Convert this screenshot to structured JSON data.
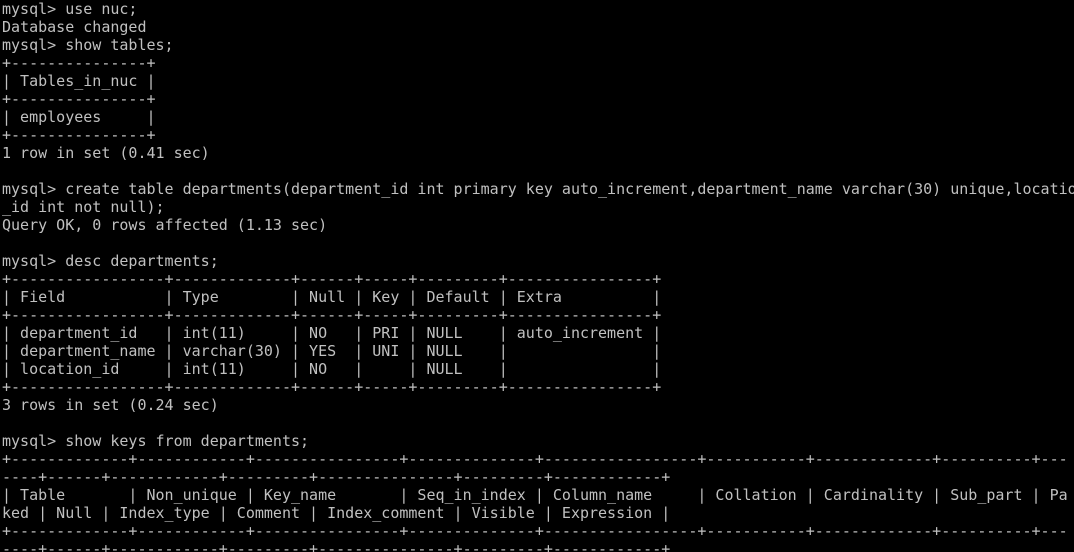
{
  "window": {
    "type": "terminal",
    "background": "#000000",
    "foreground": "#c0c0c0"
  },
  "console": {
    "lines": [
      "mysql> use nuc;",
      "Database changed",
      "mysql> show tables;",
      "+---------------+",
      "| Tables_in_nuc |",
      "+---------------+",
      "| employees     |",
      "+---------------+",
      "1 row in set (0.41 sec)",
      "",
      "mysql> create table departments(department_id int primary key auto_increment,department_name varchar(30) unique,locatio",
      "_id int not null);",
      "Query OK, 0 rows affected (1.13 sec)",
      "",
      "mysql> desc departments;",
      "+-----------------+-------------+------+-----+---------+----------------+",
      "| Field           | Type        | Null | Key | Default | Extra          |",
      "+-----------------+-------------+------+-----+---------+----------------+",
      "| department_id   | int(11)     | NO   | PRI | NULL    | auto_increment |",
      "| department_name | varchar(30) | YES  | UNI | NULL    |                |",
      "| location_id     | int(11)     | NO   |     | NULL    |                |",
      "+-----------------+-------------+------+-----+---------+----------------+",
      "3 rows in set (0.24 sec)",
      "",
      "mysql> show keys from departments;",
      "+-------------+------------+----------------+--------------+-----------------+-----------+-------------+----------+---",
      "----+------+------------+---------+---------------+---------+------------+",
      "| Table       | Non_unique | Key_name       | Seq_in_index | Column_name     | Collation | Cardinality | Sub_part | Pa",
      "ked | Null | Index_type | Comment | Index_comment | Visible | Expression |",
      "+-------------+------------+----------------+--------------+-----------------+-----------+-------------+----------+---",
      "----+------+------------+---------+---------------+---------+------------+"
    ]
  }
}
